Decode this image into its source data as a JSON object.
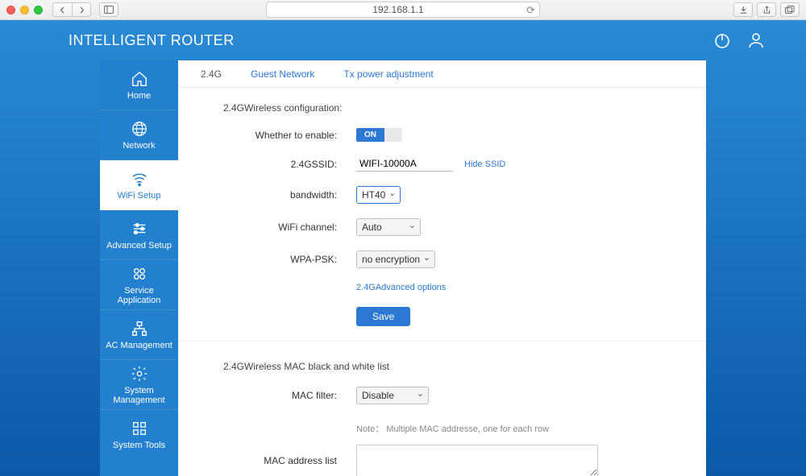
{
  "browser": {
    "address": "192.168.1.1"
  },
  "header": {
    "title": "INTELLIGENT ROUTER"
  },
  "sidebar": {
    "items": [
      {
        "id": "home",
        "label": "Home"
      },
      {
        "id": "network",
        "label": "Network"
      },
      {
        "id": "wifi",
        "label": "WiFi Setup"
      },
      {
        "id": "advanced",
        "label": "Advanced Setup"
      },
      {
        "id": "service",
        "label": "Service Application"
      },
      {
        "id": "ac",
        "label": "AC Management"
      },
      {
        "id": "sysmgmt",
        "label": "System Management"
      },
      {
        "id": "systools",
        "label": "System Tools"
      }
    ],
    "active": "wifi"
  },
  "tabs": {
    "items": [
      {
        "id": "24g",
        "label": "2.4G"
      },
      {
        "id": "guest",
        "label": "Guest Network"
      },
      {
        "id": "txpower",
        "label": "Tx power adjustment"
      }
    ],
    "active": "24g"
  },
  "wireless": {
    "section_title": "2.4GWireless configuration:",
    "labels": {
      "enable": "Whether to enable:",
      "ssid": "2.4GSSID:",
      "bandwidth": "bandwidth:",
      "channel": "WiFi channel:",
      "wpa": "WPA-PSK:",
      "advanced": "2.4GAdvanced options",
      "save": "Save"
    },
    "enable_state": "ON",
    "ssid_value": "WIFI-10000A",
    "hide_ssid_label": "Hide SSID",
    "bandwidth_value": "HT40",
    "channel_value": "Auto",
    "wpa_value": "no encryption"
  },
  "maclist": {
    "section_title": "2.4GWireless MAC black and white list",
    "labels": {
      "filter": "MAC filter:",
      "addrlist": "MAC address list"
    },
    "filter_value": "Disable",
    "note": "Note： Multiple MAC addresse, one for each row"
  }
}
